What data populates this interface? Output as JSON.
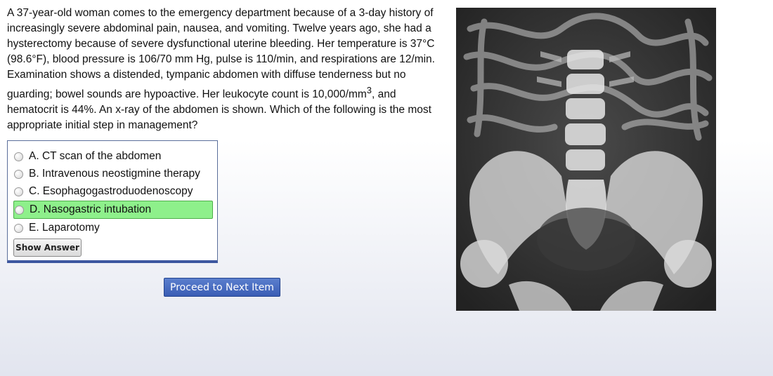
{
  "question": {
    "stem_before_superscript": "A 37-year-old woman comes to the emergency department because of a 3-day history of increasingly severe abdominal pain, nausea, and vomiting. Twelve years ago, she had a hysterectomy because of severe dysfunctional uterine bleeding. Her temperature is 37°C (98.6°F), blood pressure is 106/70 mm Hg, pulse is 110/min, and respirations are 12/min. Examination shows a distended, tympanic abdomen with diffuse tenderness but no guarding; bowel sounds are hypoactive. Her leukocyte count is 10,000/mm",
    "superscript": "3",
    "stem_after_superscript": ", and hematocrit is 44%. An x-ray of the abdomen is shown. Which of the following is the most appropriate initial step in management?"
  },
  "choices": [
    {
      "label": "A. CT scan of the abdomen",
      "correct": false
    },
    {
      "label": "B. Intravenous neostigmine therapy",
      "correct": false
    },
    {
      "label": "C. Esophagogastroduodenoscopy",
      "correct": false
    },
    {
      "label": "D. Nasogastric intubation",
      "correct": true
    },
    {
      "label": "E. Laparotomy",
      "correct": false
    }
  ],
  "buttons": {
    "show_answer": "Show Answer",
    "proceed": "Proceed to Next Item"
  },
  "colors": {
    "correct_highlight": "#8ef08b",
    "panel_border": "#3d57a0",
    "proceed_button": "#4a6dc2"
  },
  "image": {
    "kind": "abdominal x-ray"
  }
}
